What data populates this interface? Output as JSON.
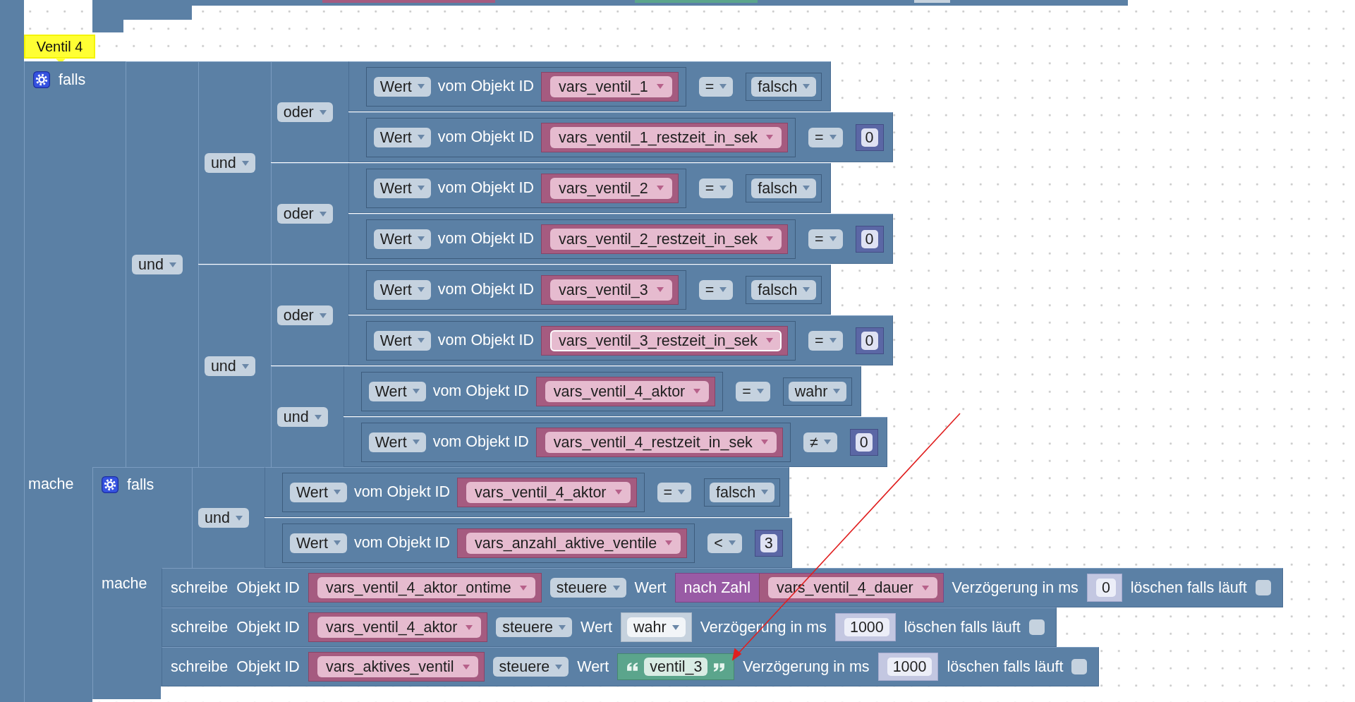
{
  "comment": {
    "text": "Ventil 4"
  },
  "if_block": {
    "if_label": "falls",
    "do_label": "mache",
    "condition": {
      "kind": "logic",
      "op": "und",
      "a": {
        "kind": "logic",
        "op": "und",
        "a": {
          "kind": "logic",
          "op": "oder",
          "a": {
            "kind": "compare",
            "left": {
              "attr": "Wert",
              "label": "vom Objekt ID",
              "object": {
                "id": "vars_ventil_1",
                "selected": false
              }
            },
            "op": "=",
            "right": {
              "kind": "bool",
              "value": "falsch",
              "shadow": false
            }
          },
          "b": {
            "kind": "compare",
            "left": {
              "attr": "Wert",
              "label": "vom Objekt ID",
              "object": {
                "id": "vars_ventil_1_restzeit_in_sek",
                "selected": false
              }
            },
            "op": "=",
            "right": {
              "kind": "number",
              "value": "0"
            }
          }
        },
        "b": {
          "kind": "logic",
          "op": "oder",
          "a": {
            "kind": "compare",
            "left": {
              "attr": "Wert",
              "label": "vom Objekt ID",
              "object": {
                "id": "vars_ventil_2",
                "selected": false
              }
            },
            "op": "=",
            "right": {
              "kind": "bool",
              "value": "falsch",
              "shadow": false
            }
          },
          "b": {
            "kind": "compare",
            "left": {
              "attr": "Wert",
              "label": "vom Objekt ID",
              "object": {
                "id": "vars_ventil_2_restzeit_in_sek",
                "selected": false
              }
            },
            "op": "=",
            "right": {
              "kind": "number",
              "value": "0"
            }
          }
        }
      },
      "b": {
        "kind": "logic",
        "op": "und",
        "a": {
          "kind": "logic",
          "op": "oder",
          "a": {
            "kind": "compare",
            "left": {
              "attr": "Wert",
              "label": "vom Objekt ID",
              "object": {
                "id": "vars_ventil_3",
                "selected": false
              }
            },
            "op": "=",
            "right": {
              "kind": "bool",
              "value": "falsch",
              "shadow": false
            }
          },
          "b": {
            "kind": "compare",
            "left": {
              "attr": "Wert",
              "label": "vom Objekt ID",
              "object": {
                "id": "vars_ventil_3_restzeit_in_sek",
                "selected": true
              }
            },
            "op": "=",
            "right": {
              "kind": "number",
              "value": "0"
            }
          }
        },
        "b": {
          "kind": "logic",
          "op": "und",
          "a": {
            "kind": "compare",
            "left": {
              "attr": "Wert",
              "label": "vom Objekt ID",
              "object": {
                "id": "vars_ventil_4_aktor",
                "selected": false
              }
            },
            "op": "=",
            "right": {
              "kind": "bool",
              "value": "wahr",
              "shadow": false
            }
          },
          "b": {
            "kind": "compare",
            "left": {
              "attr": "Wert",
              "label": "vom Objekt ID",
              "object": {
                "id": "vars_ventil_4_restzeit_in_sek",
                "selected": false
              }
            },
            "op": "≠",
            "right": {
              "kind": "number",
              "value": "0"
            }
          }
        }
      }
    },
    "statements": [
      {
        "kind": "if",
        "if_label": "falls",
        "do_label": "mache",
        "condition": {
          "kind": "logic",
          "op": "und",
          "a": {
            "kind": "compare",
            "left": {
              "attr": "Wert",
              "label": "vom Objekt ID",
              "object": {
                "id": "vars_ventil_4_aktor",
                "selected": false
              }
            },
            "op": "=",
            "right": {
              "kind": "bool",
              "value": "falsch",
              "shadow": false
            }
          },
          "b": {
            "kind": "compare",
            "left": {
              "attr": "Wert",
              "label": "vom Objekt ID",
              "object": {
                "id": "vars_anzahl_aktive_ventile",
                "selected": false
              }
            },
            "op": "<",
            "right": {
              "kind": "number",
              "value": "3"
            }
          }
        },
        "statements": [
          {
            "kind": "write",
            "label": "schreibe",
            "id_label": "Objekt ID",
            "object": {
              "id": "vars_ventil_4_aktor_ontime",
              "selected": false
            },
            "mode": "steuere",
            "value_label": "Wert",
            "value": {
              "kind": "to_number",
              "label": "nach Zahl",
              "object": {
                "id": "vars_ventil_4_dauer",
                "selected": false
              }
            },
            "delay_label": "Verzögerung in ms",
            "delay": "0",
            "clear_label": "löschen falls läuft",
            "clear": false
          },
          {
            "kind": "write",
            "label": "schreibe",
            "id_label": "Objekt ID",
            "object": {
              "id": "vars_ventil_4_aktor",
              "selected": false
            },
            "mode": "steuere",
            "value_label": "Wert",
            "value": {
              "kind": "bool",
              "value": "wahr",
              "shadow": true
            },
            "delay_label": "Verzögerung in ms",
            "delay": "1000",
            "clear_label": "löschen falls läuft",
            "clear": false
          },
          {
            "kind": "write",
            "label": "schreibe",
            "id_label": "Objekt ID",
            "object": {
              "id": "vars_aktives_ventil",
              "selected": false
            },
            "mode": "steuere",
            "value_label": "Wert",
            "value": {
              "kind": "text",
              "value": "ventil_3"
            },
            "delay_label": "Verzögerung in ms",
            "delay": "1000",
            "clear_label": "löschen falls läuft",
            "clear": false
          }
        ]
      }
    ]
  }
}
